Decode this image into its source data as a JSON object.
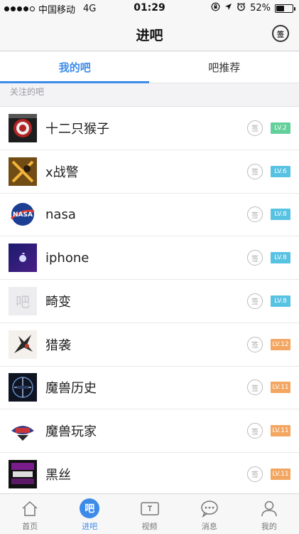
{
  "status": {
    "carrier": "中国移动",
    "network": "4G",
    "time": "01:29",
    "battery": "52%",
    "battery_level": 0.52
  },
  "nav": {
    "title": "进吧",
    "sign_label": "签"
  },
  "tabs": [
    {
      "label": "我的吧",
      "active": true
    },
    {
      "label": "吧推荐",
      "active": false
    }
  ],
  "section_label": "关注的吧",
  "forums": [
    {
      "name": "十二只猴子",
      "level": "LV.2",
      "level_color": "#63cf9a",
      "checkin": "签",
      "avatar_icon": "twelve-monkeys-icon"
    },
    {
      "name": "x战警",
      "level": "LV.6",
      "level_color": "#58c2e2",
      "checkin": "签",
      "avatar_icon": "x-men-icon"
    },
    {
      "name": "nasa",
      "level": "LV.8",
      "level_color": "#58c2e2",
      "checkin": "签",
      "avatar_icon": "nasa-icon"
    },
    {
      "name": "iphone",
      "level": "LV.8",
      "level_color": "#58c2e2",
      "checkin": "签",
      "avatar_icon": "apple-icon"
    },
    {
      "name": "畸变",
      "level": "LV.8",
      "level_color": "#58c2e2",
      "checkin": "签",
      "avatar_icon": "default-ba-icon",
      "avatar_text": "吧"
    },
    {
      "name": "猎袭",
      "level": "LV.12",
      "level_color": "#f2a661",
      "checkin": "签",
      "avatar_icon": "hunter-icon"
    },
    {
      "name": "魔兽历史",
      "level": "LV.11",
      "level_color": "#f2a661",
      "checkin": "签",
      "avatar_icon": "warcraft-icon"
    },
    {
      "name": "魔兽玩家",
      "level": "LV.11",
      "level_color": "#f2a661",
      "checkin": "签",
      "avatar_icon": "warcraft-player-icon"
    },
    {
      "name": "黑丝",
      "level": "LV.11",
      "level_color": "#f2a661",
      "checkin": "签",
      "avatar_icon": "black-icon"
    }
  ],
  "tabbar": [
    {
      "label": "首页",
      "icon": "home-icon",
      "active": false
    },
    {
      "label": "进吧",
      "icon": "ba-icon",
      "active": true,
      "icon_text": "吧"
    },
    {
      "label": "视频",
      "icon": "video-icon",
      "active": false
    },
    {
      "label": "消息",
      "icon": "message-icon",
      "active": false
    },
    {
      "label": "我的",
      "icon": "profile-icon",
      "active": false
    }
  ],
  "colors": {
    "accent": "#3d8be8",
    "level_green": "#63cf9a",
    "level_blue": "#58c2e2",
    "level_orange": "#f2a661"
  }
}
